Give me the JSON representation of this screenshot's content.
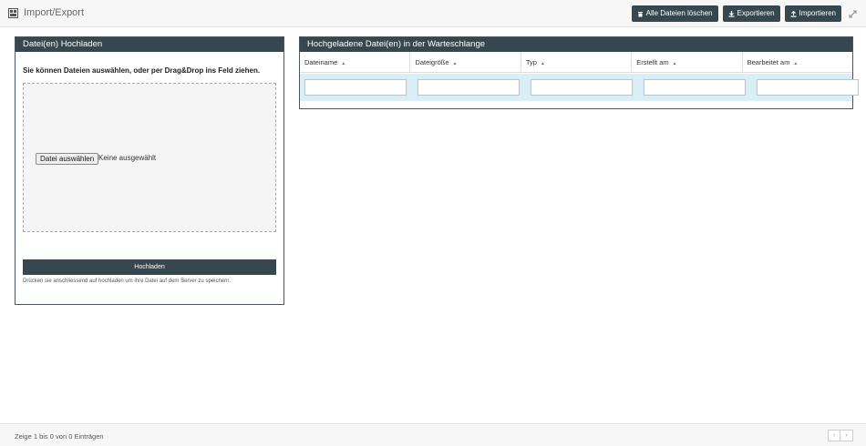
{
  "header": {
    "title": "Import/Export",
    "actions": {
      "delete_all": "Alle Dateien löschen",
      "export": "Exportieren",
      "import": "Importieren"
    }
  },
  "upload_panel": {
    "title": "Datei(en) Hochladen",
    "instructions": "Sie können Dateien auswählen, oder per Drag&Drop ins Feld ziehen.",
    "file_button": "Datei auswählen",
    "file_status": "Keine ausgewählt",
    "upload_button": "Hochladen",
    "hint": "Drücken sie anschliessend auf hochladen um ihre Datei auf dem Server zu speichern."
  },
  "queue_panel": {
    "title": "Hochgeladene Datei(en) in der Warteschlange",
    "columns": [
      "Dateiname",
      "Dateigröße",
      "Typ",
      "Erstellt am",
      "Bearbeitet am"
    ],
    "sort_icon": "▲"
  },
  "footer": {
    "info": "Zeige 1 bis 0 von 0 Einträgen",
    "prev": "‹",
    "next": "›"
  },
  "colors": {
    "header_dark": "#37474f",
    "filter_row": "#daeef6"
  }
}
